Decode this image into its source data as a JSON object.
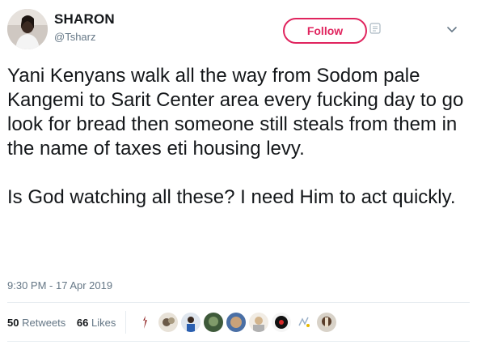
{
  "user": {
    "display_name": "SHARON",
    "handle": "@Tsharz"
  },
  "actions": {
    "follow_label": "Follow"
  },
  "tweet": {
    "paragraphs": [
      "Yani Kenyans walk all the way from Sodom pale Kangemi to Sarit Center area every fucking day to go look for bread then someone still steals from them in the name of taxes eti housing levy.",
      "Is God watching all these? I need Him to act quickly."
    ],
    "timestamp": "9:30 PM - 17 Apr 2019"
  },
  "stats": {
    "retweets_count": "50",
    "retweets_label": "Retweets",
    "likes_count": "66",
    "likes_label": "Likes"
  },
  "colors": {
    "follow": "#e0245e",
    "secondary_text": "#657786",
    "primary_text": "#14171a"
  },
  "icons": {
    "caret": "chevron-down-icon",
    "follow_bell": "notification-icon"
  }
}
